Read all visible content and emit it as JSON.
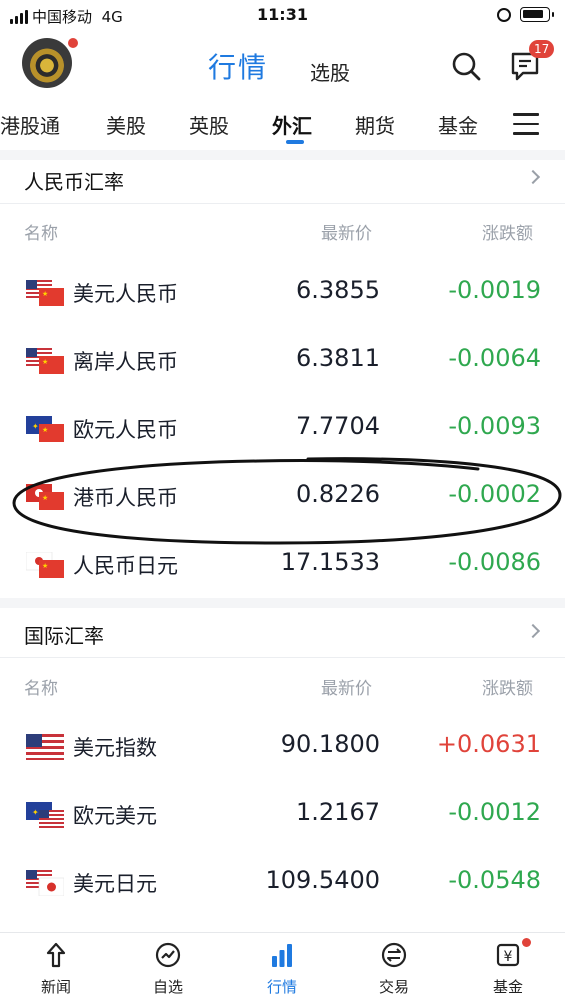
{
  "status_bar": {
    "carrier": "中国移动",
    "network": "4G",
    "time": "11:31"
  },
  "header": {
    "title": "行情",
    "subtitle": "选股",
    "message_badge": "17"
  },
  "tabs": [
    {
      "label": "港股通",
      "active": false
    },
    {
      "label": "美股",
      "active": false
    },
    {
      "label": "英股",
      "active": false
    },
    {
      "label": "外汇",
      "active": true
    },
    {
      "label": "期货",
      "active": false
    },
    {
      "label": "基金",
      "active": false
    }
  ],
  "rmb_section": {
    "title": "人民币汇率",
    "columns": {
      "name": "名称",
      "price": "最新价",
      "change": "涨跌额"
    },
    "rows": [
      {
        "flag": "us-cn-flag",
        "name": "美元人民币",
        "price": "6.3855",
        "change": "-0.0019",
        "direction": "down"
      },
      {
        "flag": "us-cn-flag",
        "name": "离岸人民币",
        "price": "6.3811",
        "change": "-0.0064",
        "direction": "down"
      },
      {
        "flag": "eu-cn-flag",
        "name": "欧元人民币",
        "price": "7.7704",
        "change": "-0.0093",
        "direction": "down"
      },
      {
        "flag": "hk-cn-flag",
        "name": "港币人民币",
        "price": "0.8226",
        "change": "-0.0002",
        "direction": "down"
      },
      {
        "flag": "cn-jp-flag",
        "name": "人民币日元",
        "price": "17.1533",
        "change": "-0.0086",
        "direction": "down"
      }
    ]
  },
  "intl_section": {
    "title": "国际汇率",
    "columns": {
      "name": "名称",
      "price": "最新价",
      "change": "涨跌额"
    },
    "rows": [
      {
        "flag": "us-flag",
        "name": "美元指数",
        "price": "90.1800",
        "change": "+0.0631",
        "direction": "up"
      },
      {
        "flag": "eu-us-flag",
        "name": "欧元美元",
        "price": "1.2167",
        "change": "-0.0012",
        "direction": "down"
      },
      {
        "flag": "us-jp-flag",
        "name": "美元日元",
        "price": "109.5400",
        "change": "-0.0548",
        "direction": "down"
      }
    ]
  },
  "bottom_nav": [
    {
      "label": "新闻",
      "icon": "news-icon",
      "active": false
    },
    {
      "label": "自选",
      "icon": "watchlist-icon",
      "active": false
    },
    {
      "label": "行情",
      "icon": "market-icon",
      "active": true
    },
    {
      "label": "交易",
      "icon": "trade-icon",
      "active": false
    },
    {
      "label": "基金",
      "icon": "fund-icon",
      "active": false
    }
  ],
  "colors": {
    "accent": "#1f7ae0",
    "down": "#2fa84f",
    "up": "#e0433a",
    "badge": "#e0433a"
  }
}
